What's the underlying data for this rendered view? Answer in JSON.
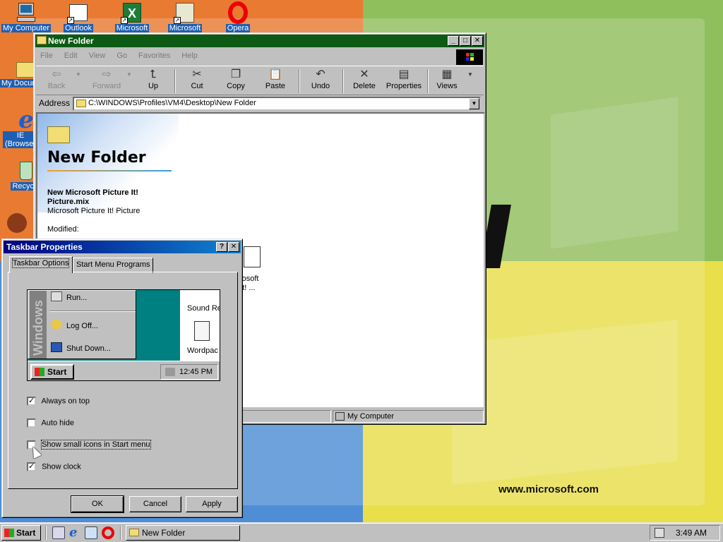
{
  "desktop": {
    "website": "www.microsoft.com",
    "icons": [
      {
        "label": "My Computer",
        "icon": "my-computer-icon"
      },
      {
        "label": "My Documents",
        "icon": "my-documents-icon"
      },
      {
        "label": "IE Browser",
        "icon": "internet-explorer-icon"
      },
      {
        "label": "Recycle Bin",
        "icon": "recycle-bin-icon"
      },
      {
        "label": "Outlook",
        "icon": "outlook-icon"
      },
      {
        "label": "Microsoft",
        "icon": "excel-icon"
      },
      {
        "label": "Microsoft",
        "icon": "picture-it-icon"
      },
      {
        "label": "Opera",
        "icon": "opera-icon"
      }
    ],
    "icon_labels_visible": {
      "my_computer": "My Computer",
      "my_documents": "My Documents",
      "ie_line1": "IE",
      "ie_line2": "(Browser",
      "recycle": "Recycle",
      "outlook": "Outlook",
      "excel": "Microsoft",
      "pictureit": "Microsoft",
      "opera": "Opera"
    }
  },
  "explorer": {
    "title": "New Folder",
    "menu": [
      "File",
      "Edit",
      "View",
      "Go",
      "Favorites",
      "Help"
    ],
    "toolbar": {
      "back": "Back",
      "forward": "Forward",
      "up": "Up",
      "cut": "Cut",
      "copy": "Copy",
      "paste": "Paste",
      "undo": "Undo",
      "delete": "Delete",
      "properties": "Properties",
      "views": "Views"
    },
    "address_label": "Address",
    "address_value": "C:\\WINDOWS\\Profiles\\VM4\\Desktop\\New Folder",
    "folder_title": "New Folder",
    "selected_file_name_line1": "New Microsoft Picture It!",
    "selected_file_name_line2": "Picture.mix",
    "selected_file_type": "Microsoft Picture It! Picture",
    "modified_label": "Modified:",
    "file_label_line1": "icrosoft",
    "file_label_line2": "e It! ...",
    "status_location": "My Computer"
  },
  "taskbar_props": {
    "title": "Taskbar Properties",
    "tabs": [
      "Taskbar Options",
      "Start Menu Programs"
    ],
    "preview": {
      "strip_text": "Windows",
      "items": [
        "Run...",
        "Log Off...",
        "Shut Down..."
      ],
      "right_items": [
        "Sound Re",
        "Wordpac"
      ],
      "start_label": "Start",
      "clock": "12:45 PM"
    },
    "options": [
      {
        "label": "Always on top",
        "checked": true
      },
      {
        "label": "Auto hide",
        "checked": false
      },
      {
        "label": "Show small icons in Start menu",
        "checked": false
      },
      {
        "label": "Show clock",
        "checked": true
      }
    ],
    "buttons": {
      "ok": "OK",
      "cancel": "Cancel",
      "apply": "Apply"
    }
  },
  "taskbar": {
    "start_label": "Start",
    "task_button": "New Folder",
    "clock": "3:49 AM"
  }
}
